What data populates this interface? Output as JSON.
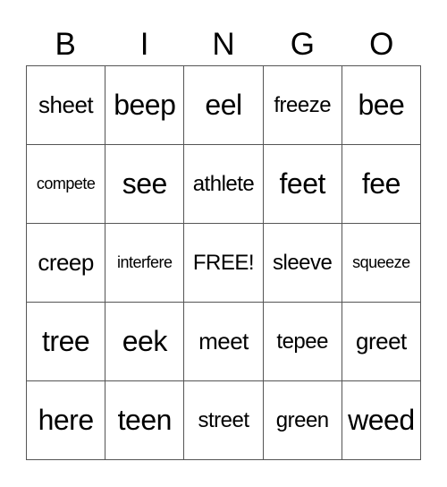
{
  "header": [
    "B",
    "I",
    "N",
    "G",
    "O"
  ],
  "rows": [
    [
      {
        "text": "sheet",
        "size": "s-md"
      },
      {
        "text": "beep",
        "size": ""
      },
      {
        "text": "eel",
        "size": ""
      },
      {
        "text": "freeze",
        "size": "s-sm"
      },
      {
        "text": "bee",
        "size": ""
      }
    ],
    [
      {
        "text": "compete",
        "size": "s-xxs"
      },
      {
        "text": "see",
        "size": ""
      },
      {
        "text": "athlete",
        "size": "s-sm"
      },
      {
        "text": "feet",
        "size": ""
      },
      {
        "text": "fee",
        "size": ""
      }
    ],
    [
      {
        "text": "creep",
        "size": "s-md"
      },
      {
        "text": "interfere",
        "size": "s-xxs"
      },
      {
        "text": "FREE!",
        "size": "s-sm"
      },
      {
        "text": "sleeve",
        "size": "s-sm"
      },
      {
        "text": "squeeze",
        "size": "s-xxs"
      }
    ],
    [
      {
        "text": "tree",
        "size": ""
      },
      {
        "text": "eek",
        "size": ""
      },
      {
        "text": "meet",
        "size": "s-md"
      },
      {
        "text": "tepee",
        "size": "s-sm"
      },
      {
        "text": "greet",
        "size": "s-md"
      }
    ],
    [
      {
        "text": "here",
        "size": ""
      },
      {
        "text": "teen",
        "size": ""
      },
      {
        "text": "street",
        "size": "s-sm"
      },
      {
        "text": "green",
        "size": "s-sm"
      },
      {
        "text": "weed",
        "size": ""
      }
    ]
  ]
}
